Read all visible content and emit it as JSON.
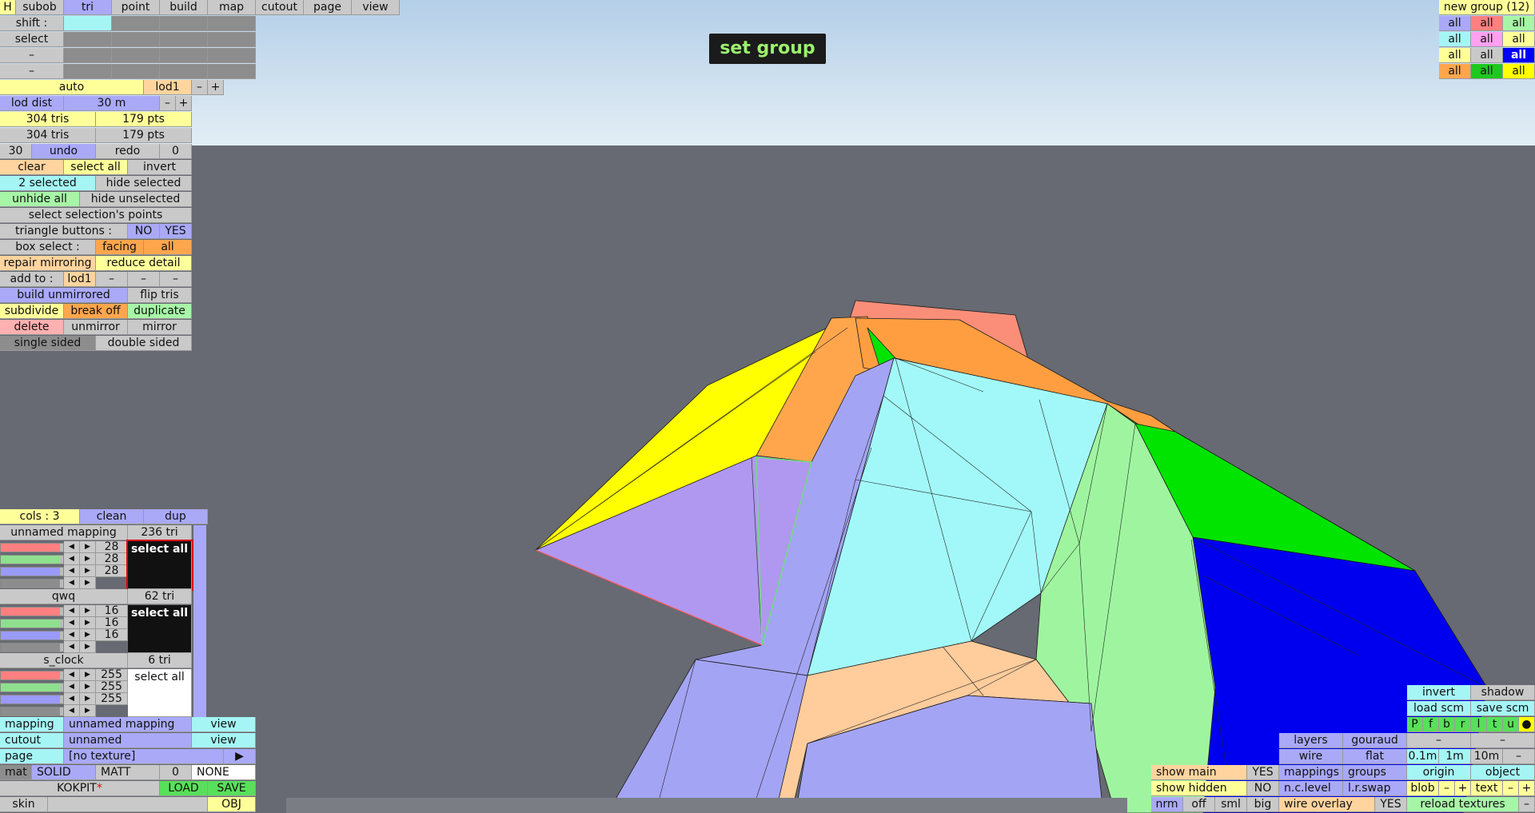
{
  "top_tabs": [
    "H",
    "subob",
    "tri",
    "point",
    "build",
    "map",
    "cutout",
    "page",
    "view"
  ],
  "rows": {
    "shift": "shift :",
    "select": "select",
    "dash": "–"
  },
  "lod": {
    "auto": "auto",
    "lod1": "lod1",
    "minus": "–",
    "plus": "+",
    "lod_dist_label": "lod dist",
    "lod_dist_value": "30 m"
  },
  "stats": {
    "tris1": "304 tris",
    "pts1": "179 pts",
    "tris2": "304 tris",
    "pts2": "179 pts"
  },
  "undo": {
    "count_left": "30",
    "undo": "undo",
    "redo": "redo",
    "count_right": "0"
  },
  "actions": {
    "clear": "clear",
    "select_all": "select all",
    "invert": "invert",
    "selected": "2 selected",
    "hide_selected": "hide selected",
    "unhide_all": "unhide all",
    "hide_unselected": "hide unselected",
    "select_points": "select selection's points",
    "tri_buttons": "triangle buttons :",
    "no": "NO",
    "yes": "YES",
    "box_select": "box select :",
    "facing": "facing",
    "all": "all",
    "repair_mirroring": "repair mirroring",
    "reduce_detail": "reduce detail",
    "add_to": "add to :",
    "add_lod": "lod1",
    "build_unmirrored": "build unmirrored",
    "flip_tris": "flip tris",
    "subdivide": "subdivide",
    "break_off": "break off",
    "duplicate": "duplicate",
    "delete": "delete",
    "unmirror": "unmirror",
    "mirror": "mirror",
    "single_sided": "single sided",
    "double_sided": "double sided"
  },
  "set_group": "set group",
  "groups_panel": {
    "title": "new group (12)",
    "cells": [
      "all",
      "all",
      "all",
      "all",
      "all",
      "all",
      "all",
      "all",
      "all",
      "all",
      "all",
      "all"
    ],
    "colors": [
      "#a9a9f8",
      "#ff8080",
      "#a7f5a7",
      "#a5f5f5",
      "#ffa0f0",
      "#ffff9a",
      "#ffff9a",
      "#c9c9c9",
      "#0000ff",
      "#ffa64d",
      "#1ec81e",
      "#ffff00"
    ]
  },
  "mappings": {
    "cols": "cols : 3",
    "clean": "clean",
    "dup": "dup",
    "items": [
      {
        "name": "unnamed mapping",
        "count": "236 tri",
        "values": [
          "28",
          "28",
          "28"
        ],
        "select": "select all",
        "swatch": "#111111"
      },
      {
        "name": "qwq",
        "count": "62 tri",
        "values": [
          "16",
          "16",
          "16"
        ],
        "select": "select all",
        "swatch": "#111111"
      },
      {
        "name": "s_clock",
        "count": "6 tri",
        "values": [
          "255",
          "255",
          "255"
        ],
        "select": "select all",
        "swatch": "#ffffff"
      }
    ]
  },
  "bottom_left": {
    "mapping_label": "mapping",
    "mapping_value": "unnamed mapping",
    "view1": "view",
    "cutout_label": "cutout",
    "cutout_value": "unnamed",
    "view2": "view",
    "page_label": "page",
    "page_value": "[no texture]",
    "play": "▶",
    "mat": "mat",
    "solid": "SOLID",
    "matt": "MATT",
    "mat_num": "0",
    "none": "NONE",
    "kokpit": "KOKPIT",
    "star": "*",
    "load": "LOAD",
    "save": "SAVE",
    "skin": "skin",
    "obj": "OBJ"
  },
  "bottom_right": {
    "invert": "invert",
    "shadow": "shadow",
    "load_scm": "load scm",
    "save_scm": "save scm",
    "letters": [
      "P",
      "f",
      "b",
      "r",
      "l",
      "t",
      "u",
      "●"
    ],
    "layers": "layers",
    "gouraud": "gouraud",
    "dash": "–",
    "wire": "wire",
    "flat": "flat",
    "d01": "0.1m",
    "d1": "1m",
    "d10": "10m",
    "show_main": "show main",
    "yes1": "YES",
    "mappings": "mappings",
    "groups": "groups",
    "origin": "origin",
    "object": "object",
    "show_hidden": "show hidden",
    "no1": "NO",
    "nclevel": "n.c.level",
    "lrswap": "l.r.swap",
    "blob": "blob",
    "minus": "–",
    "plus": "+",
    "text": "text",
    "nrm": "nrm",
    "off": "off",
    "sml": "sml",
    "big": "big",
    "wire_overlay": "wire overlay",
    "yes2": "YES",
    "reload_textures": "reload textures"
  }
}
